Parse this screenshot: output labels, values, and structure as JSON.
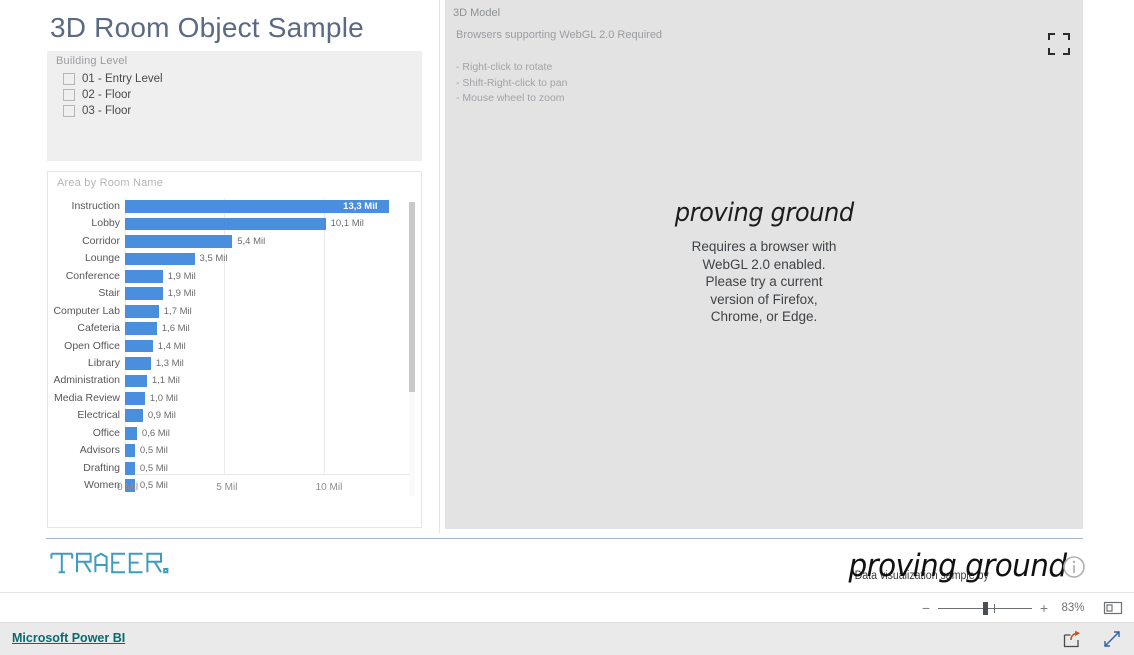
{
  "report": {
    "title": "3D Room Object Sample"
  },
  "slicer": {
    "title": "Building Level",
    "items": [
      {
        "label": "01 - Entry Level",
        "checked": false
      },
      {
        "label": "02 - Floor",
        "checked": false
      },
      {
        "label": "03 - Floor",
        "checked": false
      }
    ]
  },
  "chart_data": {
    "type": "bar",
    "title": "Area by Room Name",
    "orientation": "horizontal",
    "xlabel": "",
    "ylabel": "",
    "xlim": [
      0,
      14.6
    ],
    "grid": true,
    "legend": "none",
    "tick_labels": [
      "0 Mil",
      "5 Mil",
      "10 Mil"
    ],
    "tick_values": [
      0,
      5,
      10
    ],
    "unit_suffix": "Mil",
    "decimal_separator": ",",
    "bar_color": "#4a8ede",
    "categories": [
      "Instruction",
      "Lobby",
      "Corridor",
      "Lounge",
      "Conference",
      "Stair",
      "Computer Lab",
      "Cafeteria",
      "Open Office",
      "Library",
      "Administration",
      "Media Review",
      "Electrical",
      "Office",
      "Advisors",
      "Drafting",
      "Women"
    ],
    "values": [
      13.3,
      10.1,
      5.4,
      3.5,
      1.9,
      1.9,
      1.7,
      1.6,
      1.4,
      1.3,
      1.1,
      1.0,
      0.9,
      0.6,
      0.5,
      0.5,
      0.5
    ],
    "data_labels": [
      "13,3 Mil",
      "10,1 Mil",
      "5,4 Mil",
      "3,5 Mil",
      "1,9 Mil",
      "1,9 Mil",
      "1,7 Mil",
      "1,6 Mil",
      "1,4 Mil",
      "1,3 Mil",
      "1,1 Mil",
      "1,0 Mil",
      "0,9 Mil",
      "0,6 Mil",
      "0,5 Mil",
      "0,5 Mil",
      "0,5 Mil"
    ]
  },
  "model_panel": {
    "title": "3D Model",
    "subtitle": "Browsers supporting WebGL 2.0 Required",
    "hints": [
      "- Right-click to rotate",
      "- Shift-Right-click to pan",
      "- Mouse wheel to zoom"
    ],
    "webgl_logo": "proving ground",
    "webgl_message": "Requires a browser with WebGL 2.0 enabled. Please try a current version of Firefox, Chrome, or Edge.",
    "expand_icon": "fullscreen-icon"
  },
  "footer": {
    "brand_logo": "TRACER.",
    "credit_text": "Data visualization sample by",
    "credit_logo": "proving ground",
    "info_icon": "info-icon"
  },
  "statusbar": {
    "zoom_out_icon": "minus-icon",
    "zoom_in_icon": "plus-icon",
    "zoom_level": "83%",
    "fit_page_icon": "fit-to-page-icon"
  },
  "powerbi_bar": {
    "link_label": "Microsoft Power BI",
    "share_icon": "share-icon",
    "fullscreen_icon": "expand-arrows-icon"
  }
}
